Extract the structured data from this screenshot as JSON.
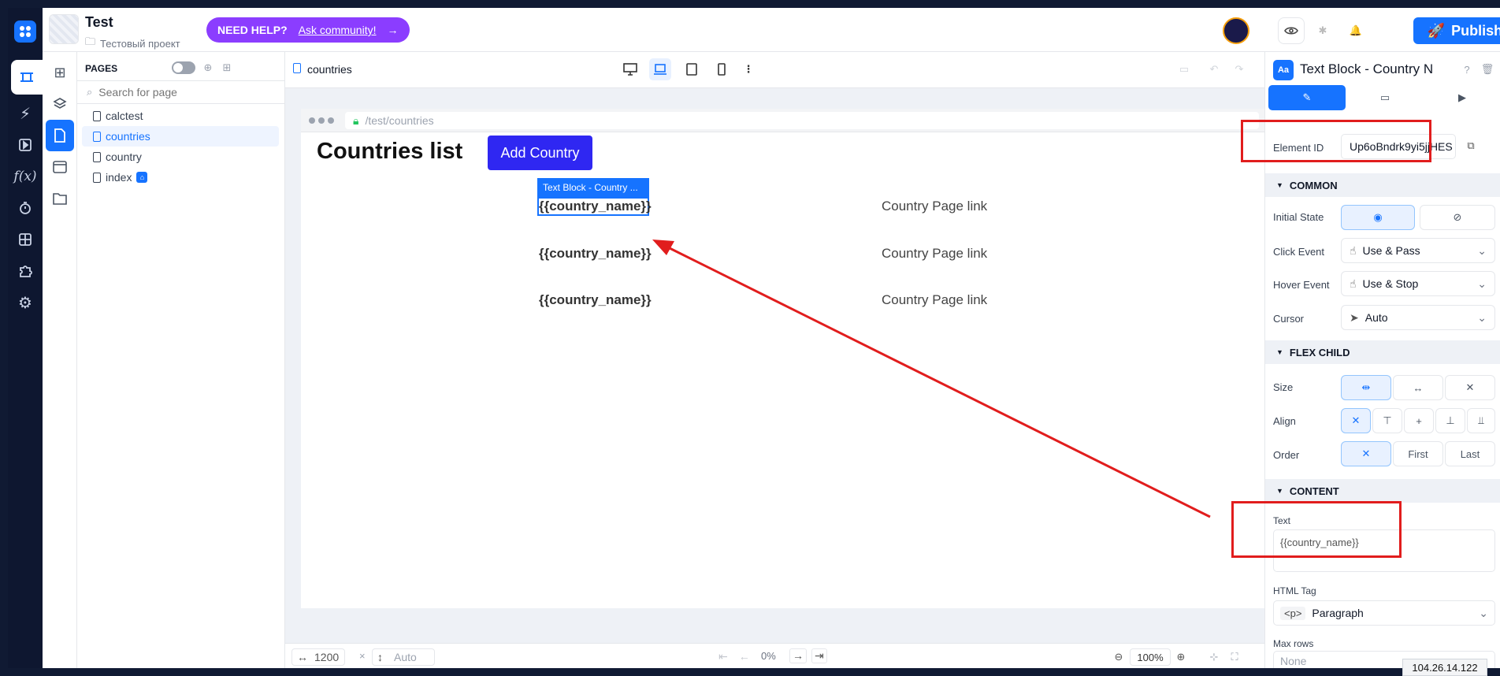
{
  "app": {
    "project_name": "Test",
    "project_folder": "Тестовый проект"
  },
  "help": {
    "label": "NEED HELP?",
    "link": "Ask community!"
  },
  "publish": {
    "label": "Publish"
  },
  "pages": {
    "title": "PAGES",
    "search_placeholder": "Search for page",
    "items": [
      "calctest",
      "countries",
      "country",
      "index"
    ],
    "selected": "countries"
  },
  "canvas": {
    "page_name": "countries",
    "url": "/test/countries",
    "heading": "Countries list",
    "add_button": "Add Country",
    "selection_tag": "Text Block - Country ...",
    "rows": [
      {
        "name": "{{country_name}}",
        "link": "Country Page link"
      },
      {
        "name": "{{country_name}}",
        "link": "Country Page link"
      },
      {
        "name": "{{country_name}}",
        "link": "Country Page link"
      }
    ],
    "width": "1200",
    "height": "Auto",
    "progress": "0%",
    "zoom": "100%"
  },
  "panel": {
    "title": "Text Block - Country N",
    "element_id_label": "Element ID",
    "element_id": "Up6oBndrk9yi5jjHES",
    "sections": {
      "common": "COMMON",
      "flex_child": "FLEX CHILD",
      "content": "CONTENT"
    },
    "initial_state_label": "Initial State",
    "click_event_label": "Click Event",
    "click_event": "Use & Pass",
    "hover_event_label": "Hover Event",
    "hover_event": "Use & Stop",
    "cursor_label": "Cursor",
    "cursor": "Auto",
    "size_label": "Size",
    "align_label": "Align",
    "order_label": "Order",
    "order_first": "First",
    "order_last": "Last",
    "text_label": "Text",
    "text_value": "{{country_name}}",
    "html_tag_label": "HTML Tag",
    "html_tag_code": "<p>",
    "html_tag": "Paragraph",
    "max_rows_label": "Max rows",
    "max_rows_placeholder": "None"
  },
  "ip_badge": "104.26.14.122",
  "colors": {
    "accent": "#1673ff",
    "help": "#8b3dff",
    "annotation": "#e11d1d",
    "button": "#2f27f2"
  }
}
